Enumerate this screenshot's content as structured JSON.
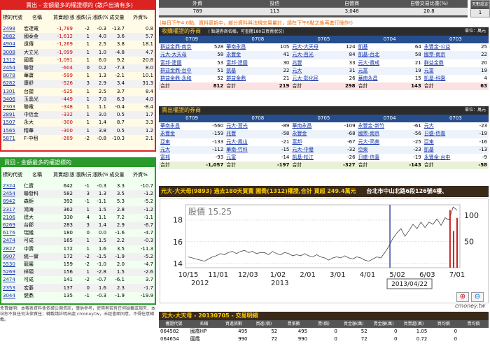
{
  "sell_box": {
    "title": "賣出 - 金額最多的權證標的 (散戶出清有多)",
    "headers": [
      "標的代號",
      "名稱",
      "買賣超(張)",
      "漲跌(元)",
      "漲跌(%)",
      "成交量",
      "外資%"
    ],
    "rows": [
      [
        "2498",
        "宏達電",
        "-1,789",
        "-2",
        "-0.3",
        "-13.7",
        "0.8"
      ],
      [
        "2882",
        "國泰金",
        "-1,612",
        "1",
        "4.0",
        "3.6",
        "5.7"
      ],
      [
        "4904",
        "遠傳",
        "-1,269",
        "1",
        "2.5",
        "3.8",
        "18.1"
      ],
      [
        "3008",
        "大立光",
        "-1,099",
        "1",
        "1.0",
        "-4.8",
        "4.7"
      ],
      [
        "1312",
        "國喬",
        "-1,091",
        "1",
        "6.0",
        "9.2",
        "20.8"
      ],
      [
        "2454",
        "聯發",
        "-604",
        "0",
        "0.2",
        "-7.3",
        "8.0"
      ],
      [
        "8078",
        "華寶",
        "-599",
        "1",
        "1.3",
        "-2.1",
        "10.1"
      ],
      [
        "6282",
        "康舒",
        "-526",
        "3",
        "2.9",
        "3.4",
        "31.3"
      ],
      [
        "1301",
        "台塑",
        "-525",
        "1",
        "2.5",
        "3.7",
        "8.4"
      ],
      [
        "3406",
        "玉晶光",
        "-449",
        "1",
        "7.0",
        "6.3",
        "4.0"
      ],
      [
        "2303",
        "聯電",
        "-348",
        "1",
        "1.1",
        "-0.4",
        "-8.4"
      ],
      [
        "2891",
        "中信金",
        "-332",
        "1",
        "3.0",
        "0.5",
        "1.7"
      ],
      [
        "1507",
        "永大",
        "-300",
        "1",
        "1.4",
        "8.7",
        "3.3"
      ],
      [
        "1565",
        "精華",
        "-300",
        "1",
        "3.8",
        "0.5",
        "1.2"
      ],
      [
        "5871",
        "F-中租",
        "-289",
        "-2",
        "-0.8",
        "-10.3",
        "2.1"
      ]
    ]
  },
  "buy_box": {
    "title": "買回 - 金額最多的權證標的",
    "headers": [
      "標的代號",
      "名稱",
      "買賣超(張)",
      "漲跌(元)",
      "漲跌(%)",
      "成交量",
      "外資%"
    ],
    "rows": [
      [
        "2324",
        "仁寶",
        "642",
        "-1",
        "-0.3",
        "3.3",
        "-10.7"
      ],
      [
        "2454",
        "聯發科",
        "582",
        "3",
        "1.3",
        "3.5",
        "-1.2"
      ],
      [
        "8942",
        "森鉅",
        "392",
        "-1",
        "-1.1",
        "5.3",
        "-5.2"
      ],
      [
        "2317",
        "鴻海",
        "362",
        "1",
        "1.5",
        "2.8",
        "-1.2"
      ],
      [
        "2106",
        "建大",
        "330",
        "4",
        "1.1",
        "7.2",
        "-1.1"
      ],
      [
        "6269",
        "台郡",
        "283",
        "3",
        "1.4",
        "2.9",
        "-6.7"
      ],
      [
        "6176",
        "瑞儀",
        "180",
        "0",
        "0.0",
        "-1.6",
        "-4.7"
      ],
      [
        "2474",
        "可成",
        "165",
        "1",
        "1.5",
        "2.2",
        "-0.3"
      ],
      [
        "2827",
        "中壽",
        "172",
        "1",
        "1.6",
        "3.5",
        "-11.3"
      ],
      [
        "9907",
        "統一實",
        "172",
        "-2",
        "-1.5",
        "-1.9",
        "-5.2"
      ],
      [
        "5530",
        "龍巖",
        "159",
        "-2",
        "-1.0",
        "2.0",
        "-4.7"
      ],
      [
        "5269",
        "祥碩",
        "156",
        "1",
        "-2.8",
        "1.5",
        "-2.6"
      ],
      [
        "2474",
        "可成",
        "141",
        "-2",
        "-0.7",
        "-6.1",
        "3.7"
      ],
      [
        "2353",
        "宏碁",
        "137",
        "0",
        "1.6",
        "2.3",
        "-1.7"
      ],
      [
        "3044",
        "健鼎",
        "135",
        "-1",
        "-0.3",
        "-1.9",
        "-19.9"
      ]
    ]
  },
  "disclaimer": "免責聲明：本報表資料係依據公開資訊，僅供參考，使用者若有任何疑義或損失，本站恕不負任何法律責任；轉載請註明出處 cmoney.tw，未經書面同意，不得任意轉載。",
  "summary": {
    "headers": [
      "外資",
      "投信",
      "自營商",
      "自營交易比重(%)"
    ],
    "values": [
      "789",
      "113",
      "3,048",
      "20.8"
    ],
    "days_label": "天數設定",
    "days_value": "1"
  },
  "notice": "(每日下午4:0點、資料更新中，部分資料與法規交易量計，請在下午6點之後再進行操作!)",
  "buy_broker": {
    "title": "收購權證的券商",
    "subtitle": "( 點選券商名稱，可查閱180日買賣狀況)",
    "unit": "單位：萬元",
    "dates": [
      "0709",
      "0708",
      "0705",
      "0704",
      "0703"
    ],
    "rows": [
      [
        [
          "群益金鼎-南京",
          "528"
        ],
        [
          "華南永昌",
          "105"
        ],
        [
          "元大-大天母",
          "124"
        ],
        [
          "凱基",
          "64"
        ],
        [
          "永豐金-公益",
          "25"
        ]
      ],
      [
        [
          "元大-大天母",
          "58"
        ],
        [
          "永豐金",
          "41"
        ],
        [
          "元大-莒光",
          "84"
        ],
        [
          "凱基-台北",
          "58"
        ],
        [
          "國票-南京",
          "22"
        ]
      ],
      [
        [
          "富邦-建國",
          "53"
        ],
        [
          "富邦-建國",
          "30"
        ],
        [
          "兆豐",
          "33"
        ],
        [
          "元大-寶成",
          "21"
        ],
        [
          "群益金鼎",
          "20"
        ]
      ],
      [
        [
          "群益金鼎-台中",
          "51"
        ],
        [
          "凱基",
          "22"
        ],
        [
          "元大",
          "31"
        ],
        [
          "元富",
          "19"
        ],
        [
          "元富",
          "19"
        ]
      ],
      [
        [
          "群益金鼎-永和",
          "52"
        ],
        [
          "群益金鼎",
          "21"
        ],
        [
          "元大-彰化民",
          "26"
        ],
        [
          "華南永昌",
          "15"
        ],
        [
          "凱基-科園",
          "4"
        ]
      ]
    ],
    "totals": [
      "812",
      "219",
      "298",
      "143",
      "63"
    ],
    "total_label": "合計"
  },
  "sell_broker": {
    "title": "賣出權證的券商",
    "unit": "單位：萬元",
    "dates": [
      "0709",
      "0708",
      "0705",
      "0704",
      "0703"
    ],
    "rows": [
      [
        [
          "華南永昌",
          "-560"
        ],
        [
          "元大-莒光",
          "-89"
        ],
        [
          "華南永昌",
          "-109"
        ],
        [
          "永豐金-新竹",
          "-61"
        ],
        [
          "元大",
          "-23"
        ]
      ],
      [
        [
          "永豐金",
          "-159"
        ],
        [
          "兆豐",
          "-58"
        ],
        [
          "永豐金",
          "-68"
        ],
        [
          "國票-南京",
          "-56"
        ],
        [
          "日盛-信義",
          "-19"
        ]
      ],
      [
        [
          "亞東",
          "-133"
        ],
        [
          "元大-鳳山",
          "-21"
        ],
        [
          "富邦",
          "-67"
        ],
        [
          "元大-高美",
          "-25"
        ],
        [
          "亞東",
          "-16"
        ]
      ],
      [
        [
          "元大",
          "-112"
        ],
        [
          "華南-竹科",
          "-15"
        ],
        [
          "元大-中壢",
          "-32"
        ],
        [
          "亞東",
          "-23"
        ],
        [
          "凱基",
          "-13"
        ]
      ],
      [
        [
          "富邦",
          "-93"
        ],
        [
          "元富",
          "-14"
        ],
        [
          "凱基-松江",
          "-26"
        ],
        [
          "日盛-信義",
          "-19"
        ],
        [
          "永豐金-台中",
          "-9"
        ]
      ]
    ],
    "totals": [
      "-1,057",
      "-197",
      "-327",
      "-143",
      "-58"
    ],
    "total_label": "合計"
  },
  "chart_header": {
    "text": "元大-大天母(9893) 過去180天買賣 國喬(1312)權證,合計 買超 249.4萬元",
    "scroll": "台北市中山北路6段126號4樓、"
  },
  "chart_data": {
    "type": "line",
    "title": "股價 15.25",
    "x_ticks": [
      "10/15",
      "11/01",
      "12/03",
      "1/02",
      "2/01",
      "3/01",
      "4/01",
      "5/02",
      "6/03",
      "7/01"
    ],
    "x_years": [
      "2012",
      "2013"
    ],
    "price_y_ticks": [
      "18",
      "16",
      "14"
    ],
    "volume_y_ticks": [
      "100",
      "50"
    ],
    "price_series": [
      14.6,
      14.5,
      14.4,
      14.3,
      14.2,
      14.4,
      14.6,
      14.7,
      14.9,
      14.8,
      15.0,
      15.1,
      14.9,
      15.1,
      15.2,
      15.0,
      15.1,
      14.9,
      15.0,
      15.0,
      14.8,
      15.1,
      14.9,
      14.8,
      15.0,
      14.9,
      14.7,
      14.8,
      14.7,
      14.9,
      14.7,
      14.6,
      14.8,
      14.6,
      14.5,
      14.3,
      14.5,
      14.6,
      14.5,
      14.7,
      14.5,
      14.4,
      14.6,
      14.5,
      14.3,
      14.2,
      14.4,
      14.6,
      14.5,
      15.0,
      15.6,
      16.3,
      16.8,
      17.2,
      16.5,
      17.0,
      17.6,
      17.2,
      17.8,
      17.3,
      17.8,
      17.6,
      18.1,
      17.5,
      18.2,
      18.0,
      19.2,
      18.9
    ],
    "volume_series": [
      0,
      0,
      0,
      0,
      0,
      0,
      0,
      0,
      0,
      0,
      0,
      0,
      0,
      0,
      0,
      0,
      0,
      0,
      0,
      0,
      0,
      0,
      0,
      0,
      0,
      0,
      0,
      0,
      0,
      0,
      0,
      0,
      0,
      0,
      0,
      0,
      0,
      0,
      0,
      0,
      0,
      0,
      0,
      0,
      0,
      0,
      0,
      0,
      0,
      0,
      0,
      0,
      0,
      0,
      0,
      0,
      0,
      0,
      0,
      0,
      0,
      0,
      0,
      0,
      0,
      0,
      0,
      0,
      0,
      0,
      0,
      0,
      0,
      0,
      110,
      70,
      95
    ],
    "tooltip_date": "2013/04/22"
  },
  "watermark": "cmoney.tw",
  "detail": {
    "title": "元大-大天母 - 20130705 - 交易明細",
    "headers": [
      "權證代號",
      "名稱",
      "買進張數",
      "買進(價)",
      "賣張數",
      "賣(價)",
      "買金額(萬)",
      "賣金額(萬)",
      "買賣超(萬)",
      "買均價",
      "賣均價"
    ],
    "rows": [
      [
        "064582",
        "國喬HP",
        "495",
        "52",
        "495",
        "0",
        "52",
        "0",
        "1.05",
        "0"
      ],
      [
        "064654",
        "國喬",
        "990",
        "72",
        "990",
        "0",
        "72",
        "0",
        "0.72",
        "0"
      ]
    ]
  }
}
